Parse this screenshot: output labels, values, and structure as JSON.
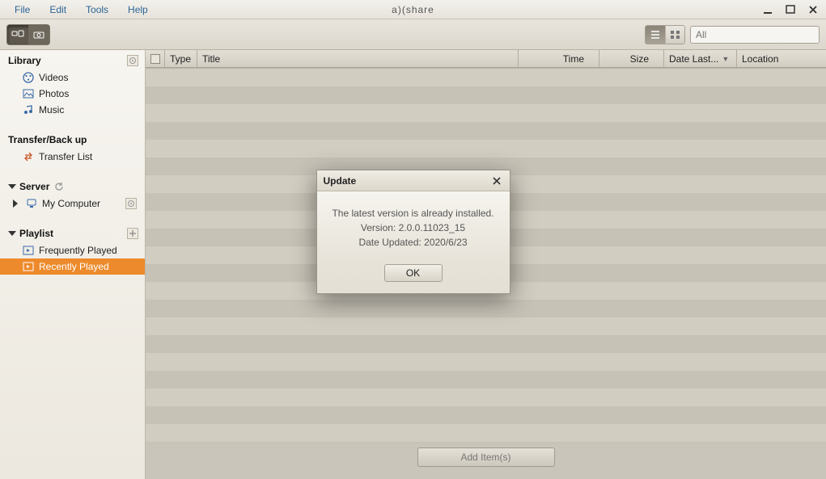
{
  "menu": {
    "file": "File",
    "edit": "Edit",
    "tools": "Tools",
    "help": "Help"
  },
  "app_title": "a)(share",
  "toolbar": {
    "search_placeholder": "All"
  },
  "sidebar": {
    "library": {
      "title": "Library",
      "items": [
        "Videos",
        "Photos",
        "Music"
      ]
    },
    "transfer": {
      "title": "Transfer/Back up",
      "item": "Transfer List"
    },
    "server": {
      "title": "Server",
      "item": "My Computer"
    },
    "playlist": {
      "title": "Playlist",
      "items": [
        "Frequently Played",
        "Recently Played"
      ]
    }
  },
  "columns": {
    "type": "Type",
    "title": "Title",
    "time": "Time",
    "size": "Size",
    "date": "Date Last...",
    "location": "Location"
  },
  "footer": {
    "add_items": "Add Item(s)"
  },
  "dialog": {
    "title": "Update",
    "line1": "The latest version is already installed.",
    "line2": "Version: 2.0.0.11023_15",
    "line3": "Date Updated: 2020/6/23",
    "ok": "OK"
  }
}
